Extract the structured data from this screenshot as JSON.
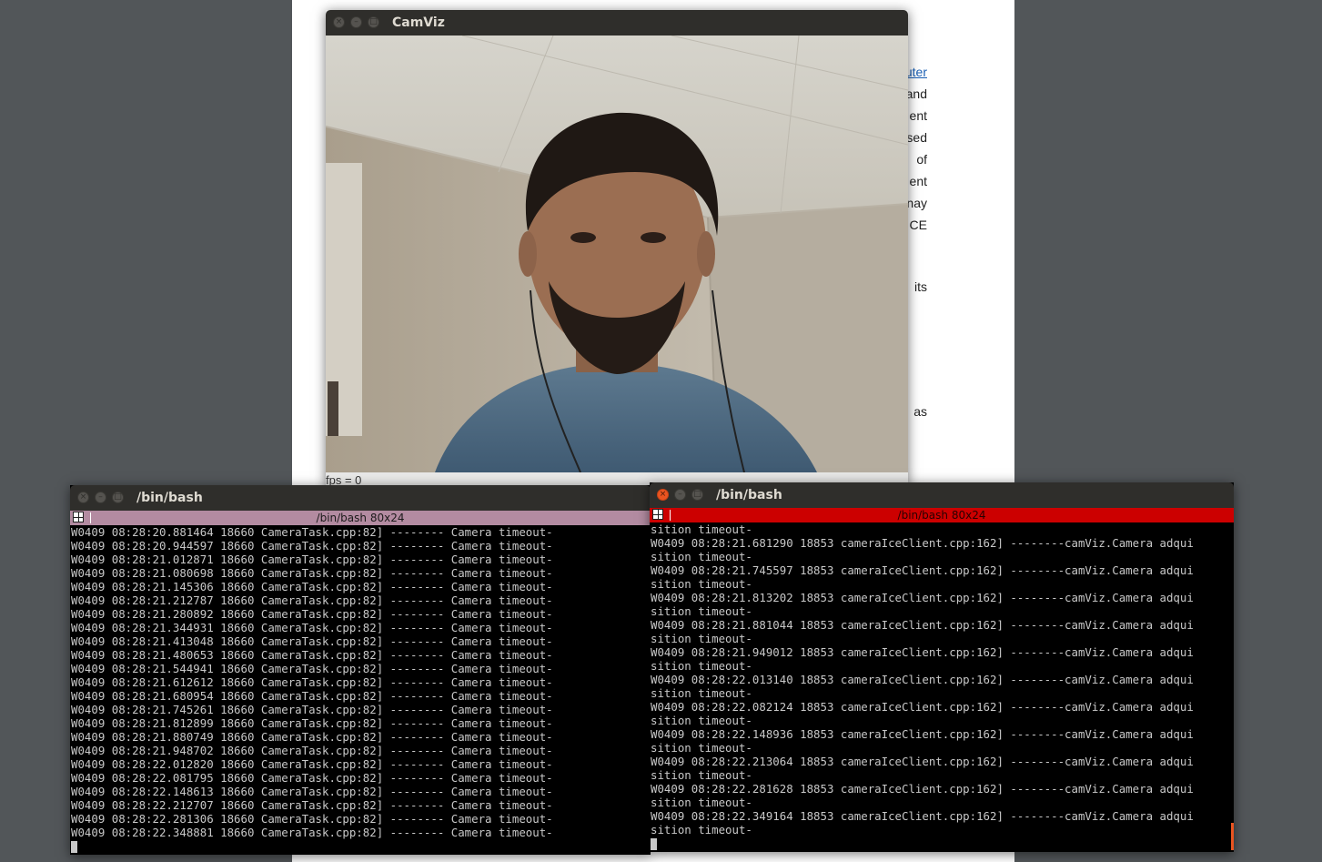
{
  "document": {
    "words": [
      "uter",
      "and",
      "ent",
      "sed",
      "of",
      "ent",
      "nay",
      "CE",
      "its",
      "as"
    ]
  },
  "camviz": {
    "title": "CamViz",
    "fps_label": "fps = 0"
  },
  "terminal_left": {
    "title": "/bin/bash",
    "tab_label": "/bin/bash 80x24",
    "lines": [
      "W0409 08:28:20.881464 18660 CameraTask.cpp:82] -------- Camera timeout-",
      "W0409 08:28:20.944597 18660 CameraTask.cpp:82] -------- Camera timeout-",
      "W0409 08:28:21.012871 18660 CameraTask.cpp:82] -------- Camera timeout-",
      "W0409 08:28:21.080698 18660 CameraTask.cpp:82] -------- Camera timeout-",
      "W0409 08:28:21.145306 18660 CameraTask.cpp:82] -------- Camera timeout-",
      "W0409 08:28:21.212787 18660 CameraTask.cpp:82] -------- Camera timeout-",
      "W0409 08:28:21.280892 18660 CameraTask.cpp:82] -------- Camera timeout-",
      "W0409 08:28:21.344931 18660 CameraTask.cpp:82] -------- Camera timeout-",
      "W0409 08:28:21.413048 18660 CameraTask.cpp:82] -------- Camera timeout-",
      "W0409 08:28:21.480653 18660 CameraTask.cpp:82] -------- Camera timeout-",
      "W0409 08:28:21.544941 18660 CameraTask.cpp:82] -------- Camera timeout-",
      "W0409 08:28:21.612612 18660 CameraTask.cpp:82] -------- Camera timeout-",
      "W0409 08:28:21.680954 18660 CameraTask.cpp:82] -------- Camera timeout-",
      "W0409 08:28:21.745261 18660 CameraTask.cpp:82] -------- Camera timeout-",
      "W0409 08:28:21.812899 18660 CameraTask.cpp:82] -------- Camera timeout-",
      "W0409 08:28:21.880749 18660 CameraTask.cpp:82] -------- Camera timeout-",
      "W0409 08:28:21.948702 18660 CameraTask.cpp:82] -------- Camera timeout-",
      "W0409 08:28:22.012820 18660 CameraTask.cpp:82] -------- Camera timeout-",
      "W0409 08:28:22.081795 18660 CameraTask.cpp:82] -------- Camera timeout-",
      "W0409 08:28:22.148613 18660 CameraTask.cpp:82] -------- Camera timeout-",
      "W0409 08:28:22.212707 18660 CameraTask.cpp:82] -------- Camera timeout-",
      "W0409 08:28:22.281306 18660 CameraTask.cpp:82] -------- Camera timeout-",
      "W0409 08:28:22.348881 18660 CameraTask.cpp:82] -------- Camera timeout-"
    ]
  },
  "terminal_right": {
    "title": "/bin/bash",
    "tab_label": "/bin/bash 80x24",
    "lines": [
      "sition timeout-",
      "W0409 08:28:21.681290 18853 cameraIceClient.cpp:162] --------camViz.Camera adqui",
      "sition timeout-",
      "W0409 08:28:21.745597 18853 cameraIceClient.cpp:162] --------camViz.Camera adqui",
      "sition timeout-",
      "W0409 08:28:21.813202 18853 cameraIceClient.cpp:162] --------camViz.Camera adqui",
      "sition timeout-",
      "W0409 08:28:21.881044 18853 cameraIceClient.cpp:162] --------camViz.Camera adqui",
      "sition timeout-",
      "W0409 08:28:21.949012 18853 cameraIceClient.cpp:162] --------camViz.Camera adqui",
      "sition timeout-",
      "W0409 08:28:22.013140 18853 cameraIceClient.cpp:162] --------camViz.Camera adqui",
      "sition timeout-",
      "W0409 08:28:22.082124 18853 cameraIceClient.cpp:162] --------camViz.Camera adqui",
      "sition timeout-",
      "W0409 08:28:22.148936 18853 cameraIceClient.cpp:162] --------camViz.Camera adqui",
      "sition timeout-",
      "W0409 08:28:22.213064 18853 cameraIceClient.cpp:162] --------camViz.Camera adqui",
      "sition timeout-",
      "W0409 08:28:22.281628 18853 cameraIceClient.cpp:162] --------camViz.Camera adqui",
      "sition timeout-",
      "W0409 08:28:22.349164 18853 cameraIceClient.cpp:162] --------camViz.Camera adqui",
      "sition timeout-"
    ]
  },
  "icons": {
    "close": "close-icon",
    "minimize": "minimize-icon",
    "maximize": "maximize-icon",
    "tab": "terminal-tab-icon"
  },
  "colors": {
    "desktop": "#525659",
    "titlebar": "#2f2e2b",
    "left_tab": "#b38ba1",
    "right_tab": "#cc0000",
    "close_active": "#e95420"
  }
}
